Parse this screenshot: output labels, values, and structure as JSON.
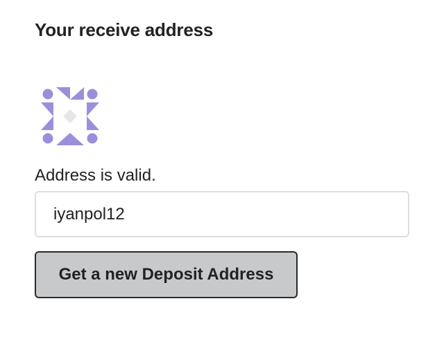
{
  "receive": {
    "title": "Your receive address",
    "identicon": {
      "name": "address-identicon",
      "primary_color": "#9b8fdb",
      "center_color": "#e6e6e6"
    },
    "status_text": "Address is valid.",
    "address_value": "iyanpol12",
    "button_label": "Get a new Deposit Address"
  }
}
